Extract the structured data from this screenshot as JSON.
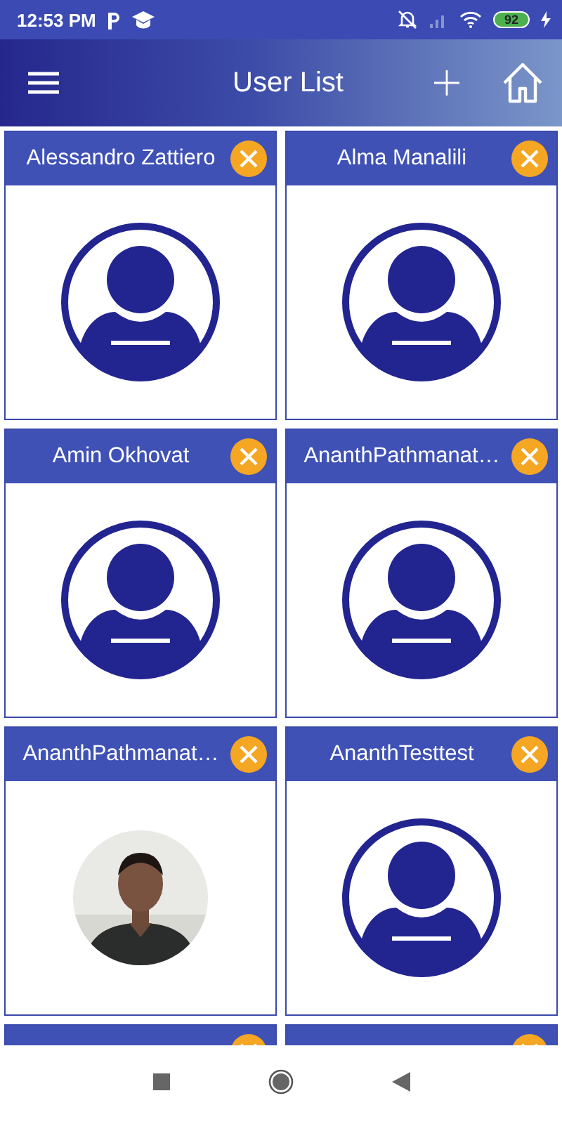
{
  "status_bar": {
    "time": "12:53 PM",
    "battery": "92"
  },
  "app_bar": {
    "title": "User List"
  },
  "users": [
    {
      "name": "Alessandro Zattiero",
      "kind": "placeholder"
    },
    {
      "name": "Alma Manalili",
      "kind": "placeholder"
    },
    {
      "name": "Amin Okhovat",
      "kind": "placeholder"
    },
    {
      "name": "AnanthPathmanat…",
      "kind": "placeholder"
    },
    {
      "name": "AnanthPathmanat…",
      "kind": "picture"
    },
    {
      "name": "AnanthTesttest",
      "kind": "placeholder"
    },
    {
      "kind": "cut_off"
    },
    {
      "kind": "cut_off"
    }
  ]
}
